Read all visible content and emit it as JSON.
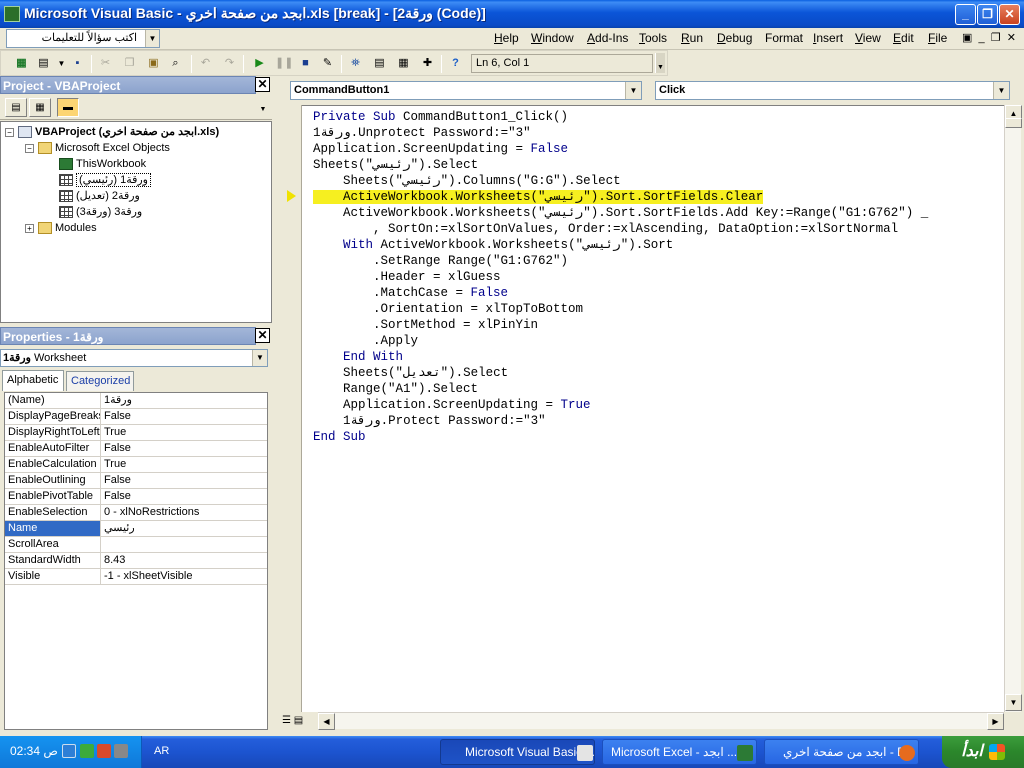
{
  "window": {
    "title": "Microsoft Visual Basic - ابجد من صفحة اخري.xls [break] - [ورقة2 (Code)]",
    "minimize": "_",
    "maximize": "❐",
    "close": "✕"
  },
  "menubar": {
    "ask_placeholder": "اكتب سؤالاً للتعليمات",
    "items": [
      {
        "name": "Help",
        "ul": "H",
        "rest": "elp"
      },
      {
        "name": "Window",
        "ul": "W",
        "rest": "indow"
      },
      {
        "name": "Add-Ins",
        "ul": "A",
        "rest": "dd-Ins"
      },
      {
        "name": "Tools",
        "ul": "T",
        "rest": "ools"
      },
      {
        "name": "Run",
        "ul": "R",
        "rest": "un"
      },
      {
        "name": "Debug",
        "ul": "D",
        "rest": "ebug"
      },
      {
        "name": "Format",
        "ul": "",
        "rest": "Format"
      },
      {
        "name": "Insert",
        "ul": "I",
        "rest": "nsert"
      },
      {
        "name": "View",
        "ul": "V",
        "rest": "iew"
      },
      {
        "name": "Edit",
        "ul": "E",
        "rest": "dit"
      },
      {
        "name": "File",
        "ul": "F",
        "rest": "ile"
      }
    ]
  },
  "toolbar": {
    "position": "Ln 6, Col 1"
  },
  "project": {
    "title": "Project - VBAProject",
    "root": "VBAProject (ابجد من صفحة اخري.xls)",
    "excel_objects": "Microsoft Excel Objects",
    "this_workbook": "ThisWorkbook",
    "sheet1": "ورقة1 (رئيسي)",
    "sheet2": "ورقة2 (تعديل)",
    "sheet3": "ورقة3 (ورقة3)",
    "modules": "Modules"
  },
  "properties": {
    "title": "Properties - ورقة1",
    "object_name": "ورقة1",
    "object_type": "Worksheet",
    "tab_alphabetic": "Alphabetic",
    "tab_categorized": "Categorized",
    "rows": [
      {
        "name": "(Name)",
        "value": "ورقة1"
      },
      {
        "name": "DisplayPageBreaks",
        "value": "False"
      },
      {
        "name": "DisplayRightToLeft",
        "value": "True"
      },
      {
        "name": "EnableAutoFilter",
        "value": "False"
      },
      {
        "name": "EnableCalculation",
        "value": "True"
      },
      {
        "name": "EnableOutlining",
        "value": "False"
      },
      {
        "name": "EnablePivotTable",
        "value": "False"
      },
      {
        "name": "EnableSelection",
        "value": "0 - xlNoRestrictions"
      },
      {
        "name": "Name",
        "value": "رئيسي"
      },
      {
        "name": "ScrollArea",
        "value": ""
      },
      {
        "name": "StandardWidth",
        "value": "8.43"
      },
      {
        "name": "Visible",
        "value": "-1 - xlSheetVisible"
      }
    ]
  },
  "code": {
    "object_combo": "CommandButton1",
    "proc_combo": "Click",
    "lines": [
      "Private Sub CommandButton1_Click()",
      "ورقة1.Unprotect Password:=\"3\"",
      "Application.ScreenUpdating = False",
      "Sheets(\"رئيسي\").Select",
      "    Sheets(\"رئيسي\").Columns(\"G:G\").Select",
      "    ActiveWorkbook.Worksheets(\"رئيسي\").Sort.SortFields.Clear",
      "    ActiveWorkbook.Worksheets(\"رئيسي\").Sort.SortFields.Add Key:=Range(\"G1:G762\") _",
      "        , SortOn:=xlSortOnValues, Order:=xlAscending, DataOption:=xlSortNormal",
      "    With ActiveWorkbook.Worksheets(\"رئيسي\").Sort",
      "        .SetRange Range(\"G1:G762\")",
      "        .Header = xlGuess",
      "        .MatchCase = False",
      "        .Orientation = xlTopToBottom",
      "        .SortMethod = xlPinYin",
      "        .Apply",
      "    End With",
      "    Sheets(\"تعديل\").Select",
      "    Range(\"A1\").Select",
      "    Application.ScreenUpdating = True",
      "    ورقة1.Protect Password:=\"3\"",
      "End Sub"
    ],
    "highlight_index": 5,
    "highlight_color": "#f6ef20",
    "keyword_color": "#00008b"
  },
  "taskbar": {
    "clock": "02:34 ص",
    "lang": "AR",
    "tasks": [
      {
        "label": "Microsoft Visual Basic ...",
        "icon": "vb-icon"
      },
      {
        "label": "Microsoft Excel - ابجد ...",
        "icon": "excel-icon"
      },
      {
        "label": "ابجد من صفحة اخري - E...",
        "icon": "firefox-icon"
      }
    ],
    "start_label": "ابدأ"
  }
}
